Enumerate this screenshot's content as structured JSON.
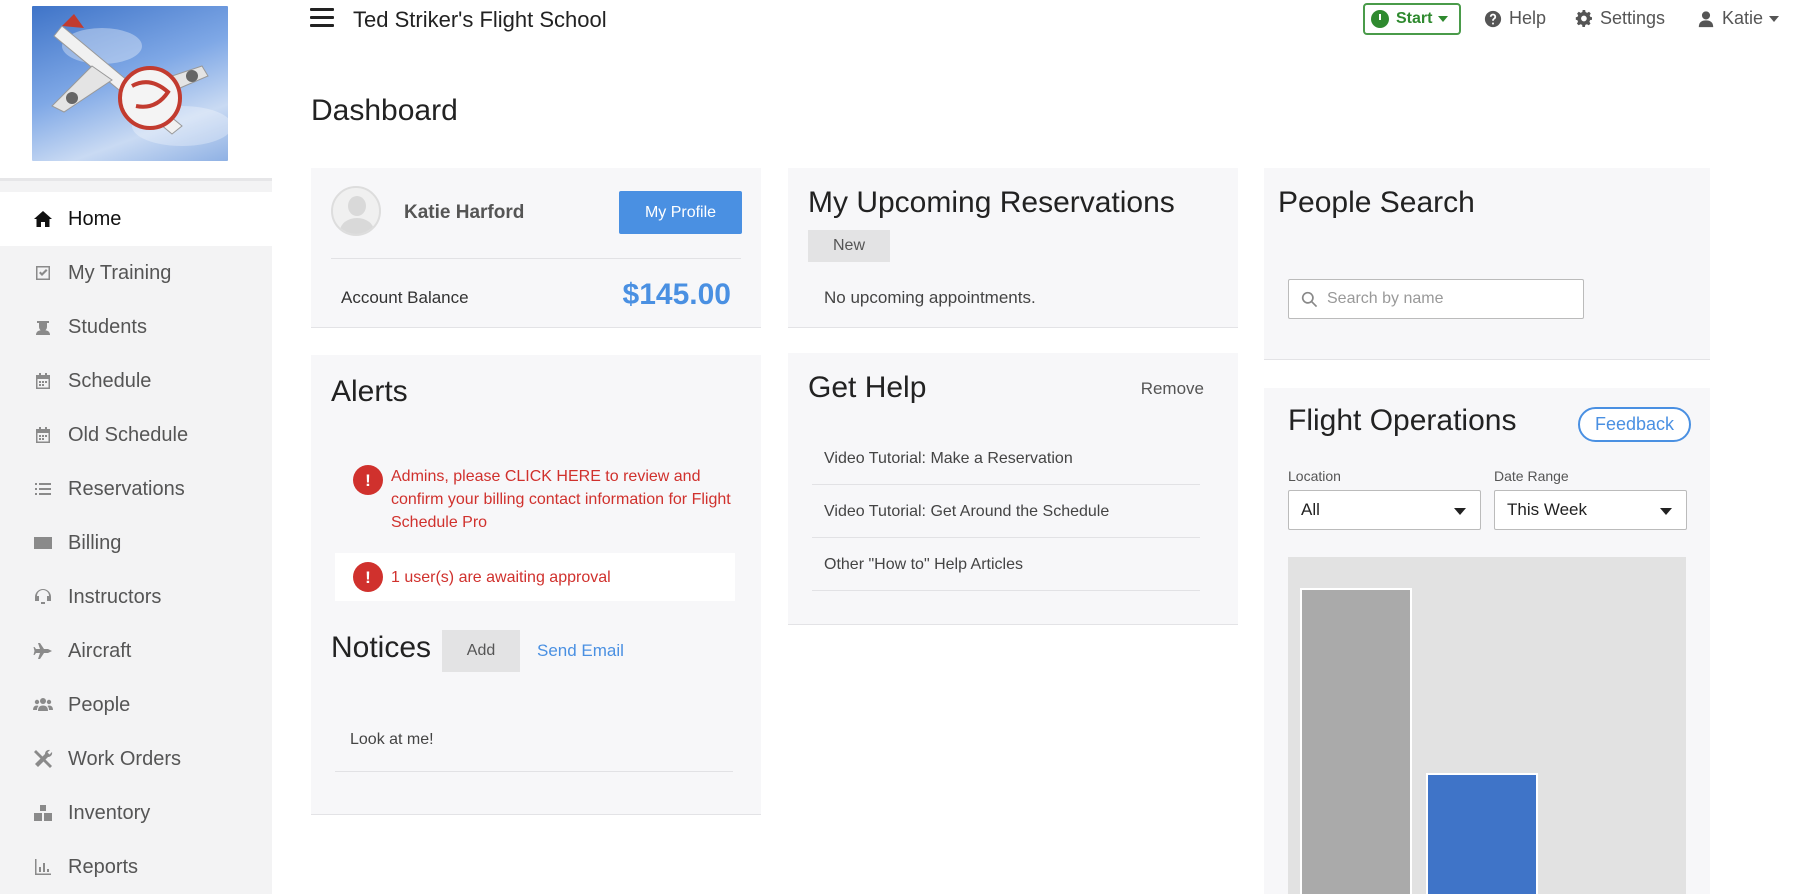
{
  "app": {
    "school_name": "Ted Striker's Flight School"
  },
  "topbar": {
    "start_label": "Start",
    "help_label": "Help",
    "settings_label": "Settings",
    "user_label": "Katie",
    "start_color": "#2f8a2f"
  },
  "sidebar": {
    "items": [
      {
        "label": "Home",
        "icon": "home-icon",
        "active": true
      },
      {
        "label": "My Training",
        "icon": "checkbox-icon"
      },
      {
        "label": "Students",
        "icon": "student-icon"
      },
      {
        "label": "Schedule",
        "icon": "calendar-icon"
      },
      {
        "label": "Old Schedule",
        "icon": "calendar-icon"
      },
      {
        "label": "Reservations",
        "icon": "list-icon"
      },
      {
        "label": "Billing",
        "icon": "card-icon"
      },
      {
        "label": "Instructors",
        "icon": "headset-icon"
      },
      {
        "label": "Aircraft",
        "icon": "plane-icon"
      },
      {
        "label": "People",
        "icon": "people-icon"
      },
      {
        "label": "Work Orders",
        "icon": "tools-icon"
      },
      {
        "label": "Inventory",
        "icon": "boxes-icon"
      },
      {
        "label": "Reports",
        "icon": "bar-chart-icon"
      }
    ]
  },
  "page": {
    "title": "Dashboard"
  },
  "profile": {
    "name": "Katie Harford",
    "profile_button": "My Profile",
    "balance_label": "Account Balance",
    "balance_value": "$145.00",
    "accent": "#4a90e2"
  },
  "alerts": {
    "title": "Alerts",
    "items": [
      "Admins, please CLICK HERE to review and confirm your billing contact information for Flight Schedule Pro",
      "1 user(s) are awaiting approval"
    ],
    "alert_color": "#d0312d"
  },
  "notices": {
    "title": "Notices",
    "add_label": "Add",
    "send_email_label": "Send Email",
    "items": [
      "Look at me!"
    ]
  },
  "reservations": {
    "title": "My Upcoming Reservations",
    "new_label": "New",
    "empty_text": "No upcoming appointments."
  },
  "help": {
    "title": "Get Help",
    "remove_label": "Remove",
    "items": [
      "Video Tutorial: Make a Reservation",
      "Video Tutorial: Get Around the Schedule",
      "Other \"How to\" Help Articles"
    ]
  },
  "people_search": {
    "title": "People Search",
    "placeholder": "Search by name"
  },
  "flight_ops": {
    "title": "Flight Operations",
    "feedback_label": "Feedback",
    "location_label": "Location",
    "location_value": "All",
    "date_range_label": "Date Range",
    "date_range_value": "This Week"
  },
  "chart_data": {
    "type": "bar",
    "categories": [
      "",
      ""
    ],
    "series": [
      {
        "values": [
          1.0,
          0.4
        ],
        "colors": [
          "#aaaaaa",
          "#3f74c8"
        ]
      }
    ],
    "ylim": [
      0,
      1.1
    ],
    "grid": false
  }
}
